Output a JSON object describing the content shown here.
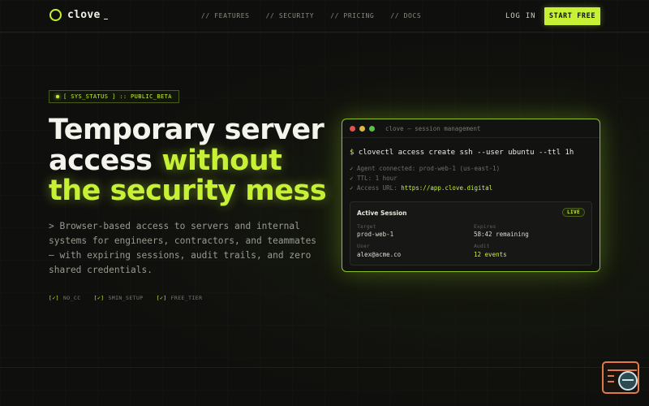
{
  "nav": {
    "brand": "clove",
    "links": [
      "// FEATURES",
      "// SECURITY",
      "// PRICING",
      "// DOCS"
    ],
    "login": "LOG IN",
    "cta": "START FREE"
  },
  "hero": {
    "status": "[ SYS_STATUS ] :: PUBLIC_BETA",
    "headline_line1": "Temporary server",
    "headline_line2_plain": "access ",
    "headline_line2_accent": "without",
    "headline_line3_accent": "the security mess",
    "lede": "> Browser-based access to servers and internal systems for engineers, contractors, and teammates — with expiring sessions, audit trails, and zero shared credentials.",
    "checks": [
      {
        "box": "[✓]",
        "label": "NO_CC"
      },
      {
        "box": "[✓]",
        "label": "5MIN_SETUP"
      },
      {
        "box": "[✓]",
        "label": "FREE_TIER"
      }
    ]
  },
  "terminal": {
    "title": "clove — session management",
    "prompt": "$",
    "command": "clovectl access create ssh --user ubuntu --ttl 1h",
    "outputs": [
      {
        "mark": "✓",
        "text": "Agent connected: prod-web-1 (us-east-1)"
      },
      {
        "mark": "✓",
        "text": "TTL: 1 hour"
      },
      {
        "mark": "✓",
        "text": "Access URL: ",
        "url": "https://app.clove.digital"
      }
    ],
    "session": {
      "title": "Active Session",
      "badge": "LIVE",
      "target_label": "Target",
      "target_value": "prod-web-1",
      "expires_label": "Expires",
      "expires_value": "58:42 remaining",
      "user_label": "User",
      "user_value": "alex@acme.co",
      "audit_label": "Audit",
      "audit_value": "12 events"
    }
  },
  "colors": {
    "accent": "#c6f135",
    "background": "#0f0f0d",
    "traffic_red": "#e0524b",
    "traffic_yellow": "#e0b93a",
    "traffic_green": "#57c24a",
    "widget_orange": "#e07a4a"
  },
  "icons": {
    "brand": "ring-logo-icon",
    "status": "pulse-dot-icon",
    "widget": "document-search-icon"
  }
}
